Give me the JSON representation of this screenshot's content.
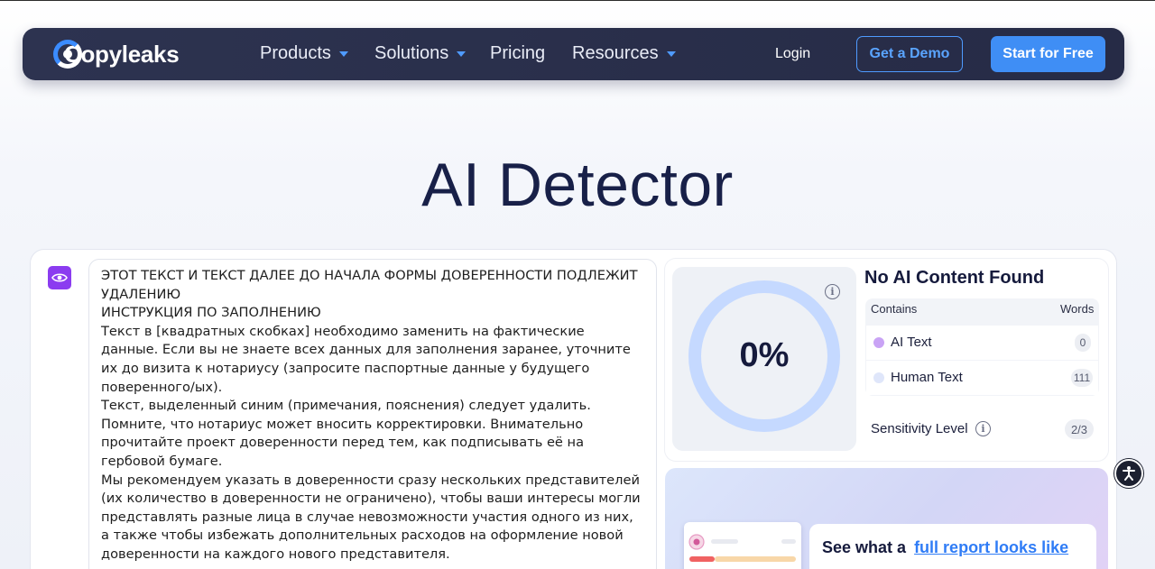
{
  "nav": {
    "logo_text": "Copyleaks",
    "items": [
      {
        "label": "Products",
        "has_dropdown": true
      },
      {
        "label": "Solutions",
        "has_dropdown": true
      },
      {
        "label": "Pricing",
        "has_dropdown": false
      },
      {
        "label": "Resources",
        "has_dropdown": true
      }
    ],
    "login_label": "Login",
    "demo_label": "Get a Demo",
    "start_label": "Start for Free"
  },
  "page_title": "AI Detector",
  "editor": {
    "icon": "eye-icon",
    "lines": [
      "ЭТОТ ТЕКСТ И ТЕКСТ ДАЛЕЕ ДО НАЧАЛА ФОРМЫ ДОВЕРЕННОСТИ ПОДЛЕЖИТ УДАЛЕНИЮ",
      "ИНСТРУКЦИЯ ПО ЗАПОЛНЕНИЮ",
      "Текст в [квадратных скобках] необходимо заменить на фактические данные. Если вы не знаете всех данных для заполнения заранее, уточните их до визита к нотариусу (запросите паспортные данные у будущего поверенного/ых).",
      "Текст, выделенный синим (примечания, пояснения) следует удалить. Помните, что нотариус может вносить корректировки. Внимательно прочитайте проект доверенности перед тем, как подписывать её на гербовой бумаге.",
      "Мы рекомендуем указать в доверенности сразу нескольких представителей (их количество в доверенности не ограничено), чтобы ваши интересы могли представлять разные лица в случае невозможности участия одного из них, а также чтобы избежать дополнительных расходов на оформление новой доверенности на каждого нового представителя."
    ]
  },
  "result": {
    "percent": "0%",
    "title": "No AI Content Found",
    "contains_label": "Contains",
    "words_label": "Words",
    "rows": [
      {
        "label": "AI Text",
        "count": "0",
        "color": "#c9a3f5"
      },
      {
        "label": "Human Text",
        "count": "111",
        "color": "#dfe6fa"
      }
    ],
    "sensitivity_label": "Sensitivity Level",
    "sensitivity_value": "2/3"
  },
  "promo": {
    "text": "See what a",
    "link": "full report looks like"
  },
  "colors": {
    "nav_bg": "#2b3150",
    "accent_blue": "#3f8ef5",
    "purple": "#8b3cf0",
    "gauge_ring": "#c5d9ff"
  }
}
